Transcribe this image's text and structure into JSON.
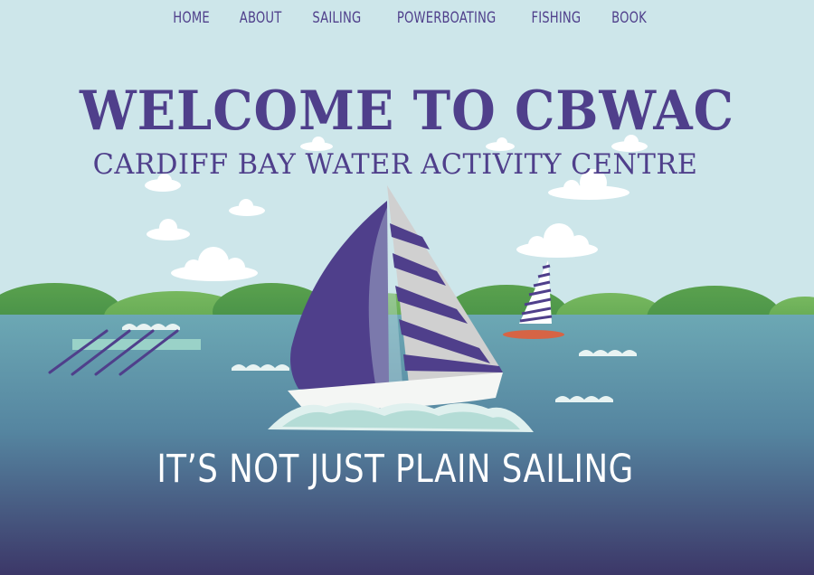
{
  "nav": {
    "items": [
      {
        "label": "HOME"
      },
      {
        "label": "ABOUT"
      },
      {
        "label": "SAILING"
      },
      {
        "label": "POWERBOATING"
      },
      {
        "label": "FISHING"
      },
      {
        "label": "BOOK"
      }
    ]
  },
  "hero": {
    "title": "WELCOME TO CBWAC",
    "subtitle": "CARDIFF BAY WATER ACTIVITY CENTRE",
    "tagline": "IT’S NOT JUST PLAIN SAILING"
  },
  "colors": {
    "sky": "#cde6ea",
    "brand_purple": "#4f3f8b",
    "hill_green": "#5aa14e",
    "water_top": "#6ca8b4",
    "water_bottom": "#3c3768"
  },
  "illustration": {
    "icons": [
      "cloud-icon",
      "hills",
      "sailboat-icon",
      "windsurfer-icon",
      "rowing-boat-icon",
      "wave-icon"
    ]
  }
}
